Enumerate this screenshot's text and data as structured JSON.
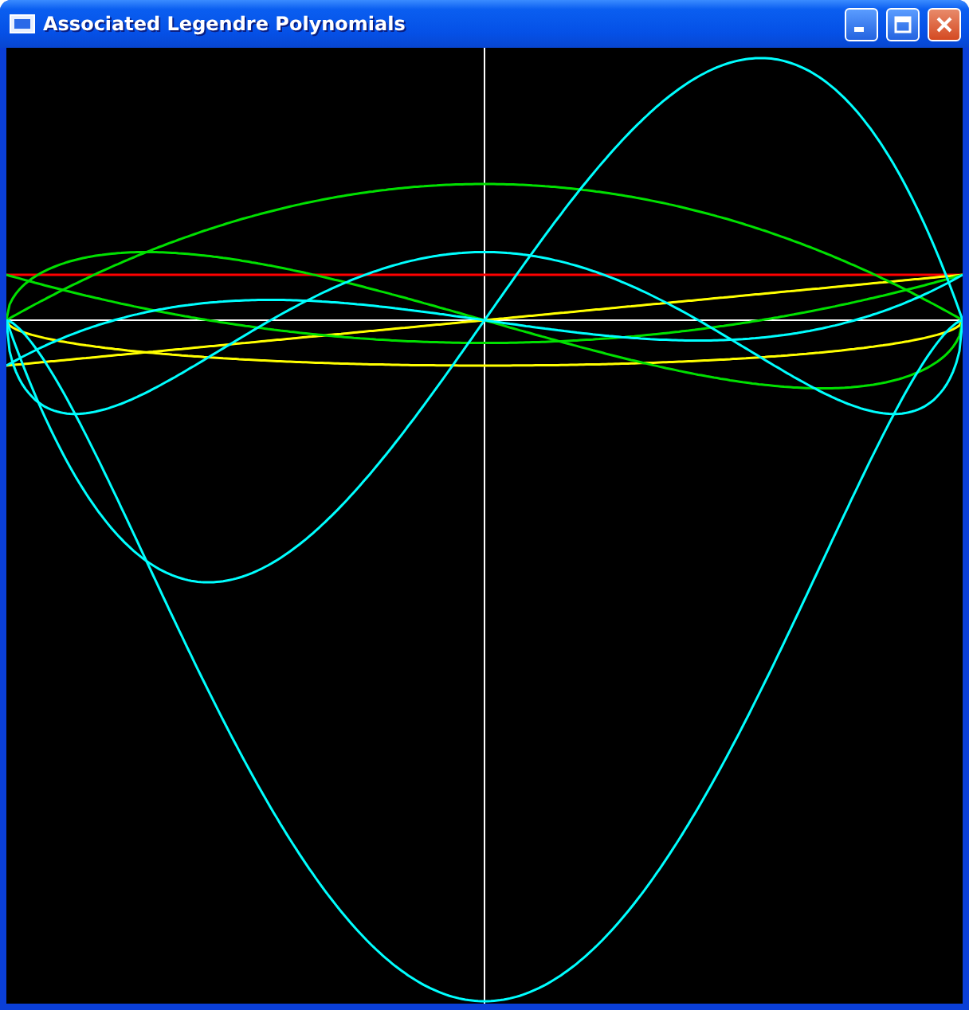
{
  "window": {
    "title": "Associated Legendre Polynomials"
  }
}
